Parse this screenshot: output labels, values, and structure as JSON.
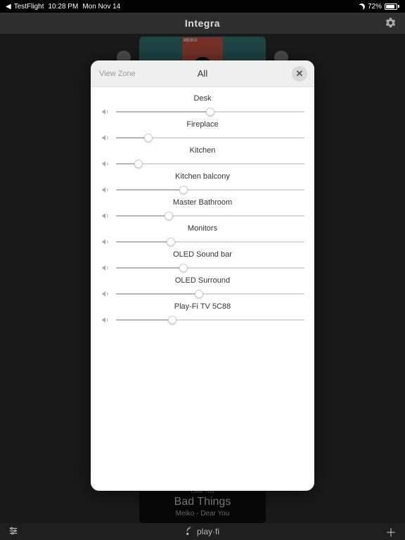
{
  "status": {
    "back_app": "TestFlight",
    "time": "10:28 PM",
    "date": "Mon Nov 14",
    "battery_pct": "72%",
    "battery_fill": 72
  },
  "app": {
    "title": "Integra"
  },
  "album": {
    "artist_caps": "MEIKO"
  },
  "now_playing": {
    "small": "Dear You",
    "title": "Bad Things",
    "sub": "Meiko - Dear You"
  },
  "bottom": {
    "brand": "play·fi"
  },
  "modal": {
    "view_zone": "View Zone",
    "title": "All",
    "zones": [
      {
        "label": "Desk",
        "value": 50
      },
      {
        "label": "Fireplace",
        "value": 17
      },
      {
        "label": "Kitchen",
        "value": 12
      },
      {
        "label": "Kitchen balcony",
        "value": 36
      },
      {
        "label": "Master Bathroom",
        "value": 28
      },
      {
        "label": "Monitors",
        "value": 29
      },
      {
        "label": "OLED Sound bar",
        "value": 36
      },
      {
        "label": "OLED Surround",
        "value": 44
      },
      {
        "label": "Play-Fi TV 5C88",
        "value": 30
      }
    ]
  }
}
